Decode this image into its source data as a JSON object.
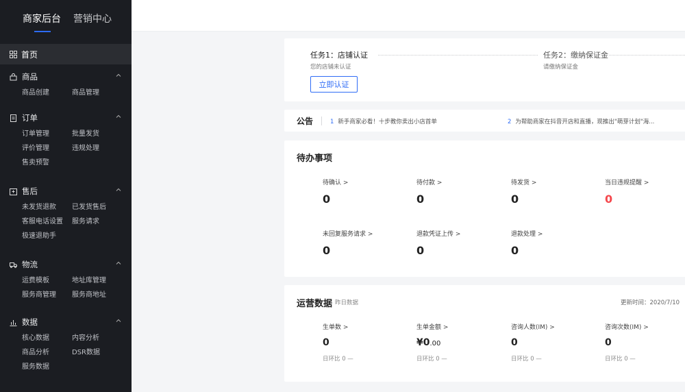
{
  "brand": {
    "tab_active": "商家后台",
    "tab_inactive": "营销中心"
  },
  "nav": {
    "home": "首页",
    "groups": [
      {
        "label": "商品",
        "items": [
          "商品创建",
          "商品管理"
        ]
      },
      {
        "label": "订单",
        "items": [
          "订单管理",
          "批量发货",
          "评价管理",
          "违规处理",
          "售卖预警"
        ]
      },
      {
        "label": "售后",
        "items": [
          "未发货退款",
          "已发货售后",
          "客服电话设置",
          "服务请求",
          "极速退助手"
        ]
      },
      {
        "label": "物流",
        "items": [
          "运费模板",
          "地址库管理",
          "服务商管理",
          "服务商地址"
        ]
      },
      {
        "label": "数据",
        "items": [
          "核心数据",
          "内容分析",
          "商品分析",
          "DSR数据",
          "服务数据"
        ]
      }
    ]
  },
  "tasks": {
    "task1_title": "任务1：店铺认证",
    "task1_sub": "您的店铺未认证",
    "task2_title": "任务2：缴纳保证金",
    "task2_sub": "请缴纳保证金",
    "verify_button": "立即认证"
  },
  "notice": {
    "title": "公告",
    "items": [
      {
        "num": "1",
        "text": "新手商家必看！十步教你卖出小店首单"
      },
      {
        "num": "2",
        "text": "为帮助商家在抖音开店和直播，现推出\"萌芽计划\"海..."
      }
    ]
  },
  "todo": {
    "title": "待办事项",
    "row1": [
      {
        "label": "待确认 >",
        "value": "0"
      },
      {
        "label": "待付款 >",
        "value": "0"
      },
      {
        "label": "待发货 >",
        "value": "0"
      },
      {
        "label": "当日违规提醒 >",
        "value": "0"
      }
    ],
    "row2": [
      {
        "label": "未回复服务请求 >",
        "value": "0"
      },
      {
        "label": "退款凭证上传 >",
        "value": "0"
      },
      {
        "label": "退款处理 >",
        "value": "0"
      }
    ]
  },
  "ops": {
    "title": "运营数据",
    "subtitle": "昨日数据",
    "updated": "更新时间：2020/7/10",
    "stats": [
      {
        "label": "生单数 >",
        "value": "0",
        "compare": "日环比 0 —"
      },
      {
        "label": "生单金额 >",
        "value_main": "¥0",
        "value_dec": ".00",
        "compare": "日环比 0 —"
      },
      {
        "label": "咨询人数(IM) >",
        "value": "0",
        "compare": "日环比 0 —"
      },
      {
        "label": "咨询次数(IM) >",
        "value": "0",
        "compare": "日环比 0 —"
      }
    ]
  },
  "colors": {
    "accent": "#2d6bf6",
    "danger": "#f5484d",
    "sidebar": "#1b1d22"
  }
}
